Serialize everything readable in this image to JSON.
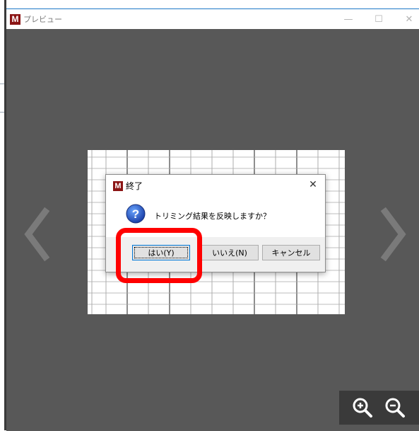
{
  "window": {
    "title": "プレビュー",
    "app_icon_letter": "M",
    "controls": {
      "minimize": "—",
      "maximize": "☐",
      "close": "✕"
    }
  },
  "navigation": {
    "prev_icon": "chevron-left-icon",
    "next_icon": "chevron-right-icon"
  },
  "dialog": {
    "title": "終了",
    "app_icon_letter": "M",
    "close": "✕",
    "message": "トリミング結果を反映しますか？",
    "icon": "question-icon",
    "buttons": {
      "yes": "はい(Y)",
      "no": "いいえ(N)",
      "cancel": "キャンセル"
    }
  },
  "zoom": {
    "zoom_in_icon": "zoom-in-icon",
    "zoom_out_icon": "zoom-out-icon"
  },
  "colors": {
    "preview_background": "#585858",
    "highlight": "#ff0000",
    "app_icon": "#8b1414",
    "accent": "#0078d7"
  }
}
